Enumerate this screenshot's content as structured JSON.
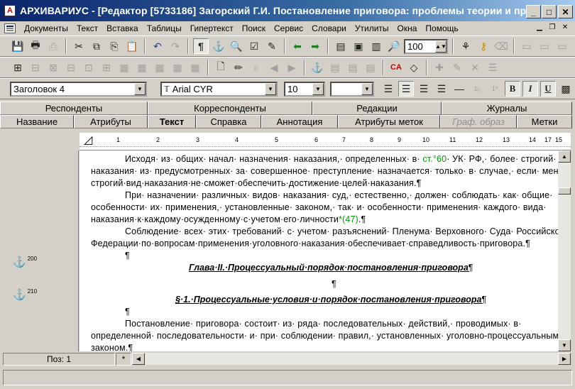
{
  "window": {
    "title": "АРХИВАРИУС - [Редактор [5733186] Загорский Г.И. Постановление приговора: проблемы теории и практик...",
    "minimize": "_",
    "maximize": "□",
    "close": "✕"
  },
  "menu": [
    "Документы",
    "Текст",
    "Вставка",
    "Таблицы",
    "Гипертекст",
    "Поиск",
    "Сервис",
    "Словари",
    "Утилиты",
    "Окна",
    "Помощь"
  ],
  "toolbar1": {
    "zoom_value": "100"
  },
  "toolbar3": {
    "style_value": "Заголовок 4",
    "font_value": "Arial CYR",
    "size_value": "10",
    "bold": "B",
    "italic": "I",
    "underline": "U"
  },
  "tabs_row1": [
    "Респонденты",
    "Корреспонденты",
    "Редакции",
    "Журналы"
  ],
  "tabs_row2": [
    "Название",
    "Атрибуты",
    "Текст",
    "Справка",
    "Аннотация",
    "Атрибуты меток",
    "Граф. образ",
    "Метки"
  ],
  "ruler": [
    "1",
    "2",
    "3",
    "4",
    "5",
    "6",
    "7",
    "8",
    "9",
    "10",
    "11",
    "12",
    "13",
    "14",
    "15",
    "16",
    "17"
  ],
  "anchors": [
    {
      "num": "200"
    },
    {
      "num": "210"
    }
  ],
  "document": {
    "p1_l1a": "Исходя· из· общих· начал· назначения· наказания,· определенных· в·",
    "p1_l1_link": " ст.°60",
    "p1_l1b": "· УК· РФ,· более· строгий· вид·",
    "p1_l2": "наказания· из· предусмотренных· за· совершенное· преступление· назначается· только· в· случае,· если· менее·",
    "p1_l3": "строгий·вид·наказания·не·сможет·обеспечить·достижение·целей·наказания.¶",
    "p2_l1": "При· назначении· различных· видов· наказания· суд,· естественно,· должен· соблюдать· как· общие·",
    "p2_l2": "особенности· их· применения,· установленные· законом,· так· и· особенности· применения· каждого· вида·",
    "p2_l3a": "наказания·к·каждому·осужденному·с·учетом·его·личности",
    "p2_l3_link": "*(47)",
    "p2_l3b": ".¶",
    "p3_l1": "Соблюдение· всех· этих· требований· с· учетом· разъяснений· Пленума· Верховного· Суда· Российской·",
    "p3_l2": "Федерации·по·вопросам·применения·уголовного·наказания·обеспечивает·справедливость·приговора.¶",
    "empty_para": "¶",
    "heading1": "Глава·II.·Процессуальный·порядок·постановления·приговора",
    "heading2": "§·1.·Процессуальные·условия·и·порядок·постановления·приговора",
    "pilcrow": "¶",
    "p4_l1": "Постановление· приговора· состоит· из· ряда· последовательных· действий,· проводимых· в·",
    "p4_l2": "определенной· последовательности· и· при· соблюдении· правил,· установленных· уголовно-процессуальным·",
    "p4_l3": "законом.¶"
  },
  "status": {
    "position": "Поз: 1",
    "modified": "*"
  }
}
